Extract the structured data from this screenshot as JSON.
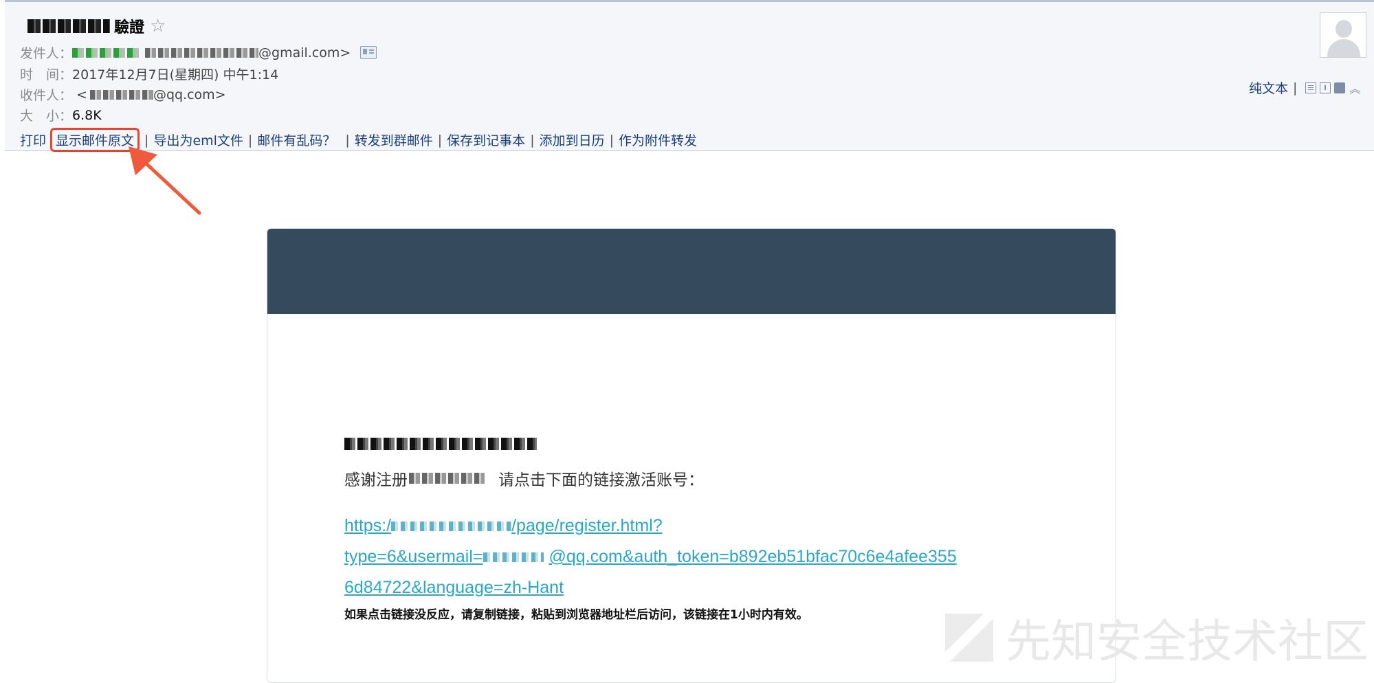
{
  "header": {
    "subject_suffix": "驗證",
    "star_icon": "☆",
    "from_label": "发件人：",
    "from_domain": "@gmail.com>",
    "time_label": "时　间：",
    "time_value": "2017年12月7日(星期四) 中午1:14",
    "to_label": "收件人：",
    "to_prefix": "<",
    "to_domain": "@qq.com>",
    "size_label": "大　小：",
    "size_value": "6.8K"
  },
  "toolbar": {
    "items": [
      "打印",
      "显示邮件原文",
      "导出为eml文件",
      "邮件有乱码？",
      "转发到群邮件",
      "保存到记事本",
      "添加到日历",
      "作为附件转发"
    ]
  },
  "right_tools": {
    "plain_text": "纯文本"
  },
  "email": {
    "thanks_start": "感谢注册",
    "thanks_end": "请点击下面的链接激活账号：",
    "link_part1": "https:/",
    "link_part2": "/page/register.html?",
    "link_part3": "type=6&usermail=",
    "link_part4": "@qq.com&auth_token=b892eb51bfac70c6e4afee355",
    "link_part5": "6d84722&language=zh-Hant",
    "note": "如果点击链接没反应，请复制链接，粘贴到浏览器地址栏后访问，该链接在1小时内有效。"
  },
  "watermark": {
    "text": "先知安全技术社区"
  },
  "colors": {
    "banner": "#364a5e",
    "link": "#28a7c8",
    "highlight": "#e8452e",
    "toolbar_link": "#1a3f7a"
  }
}
